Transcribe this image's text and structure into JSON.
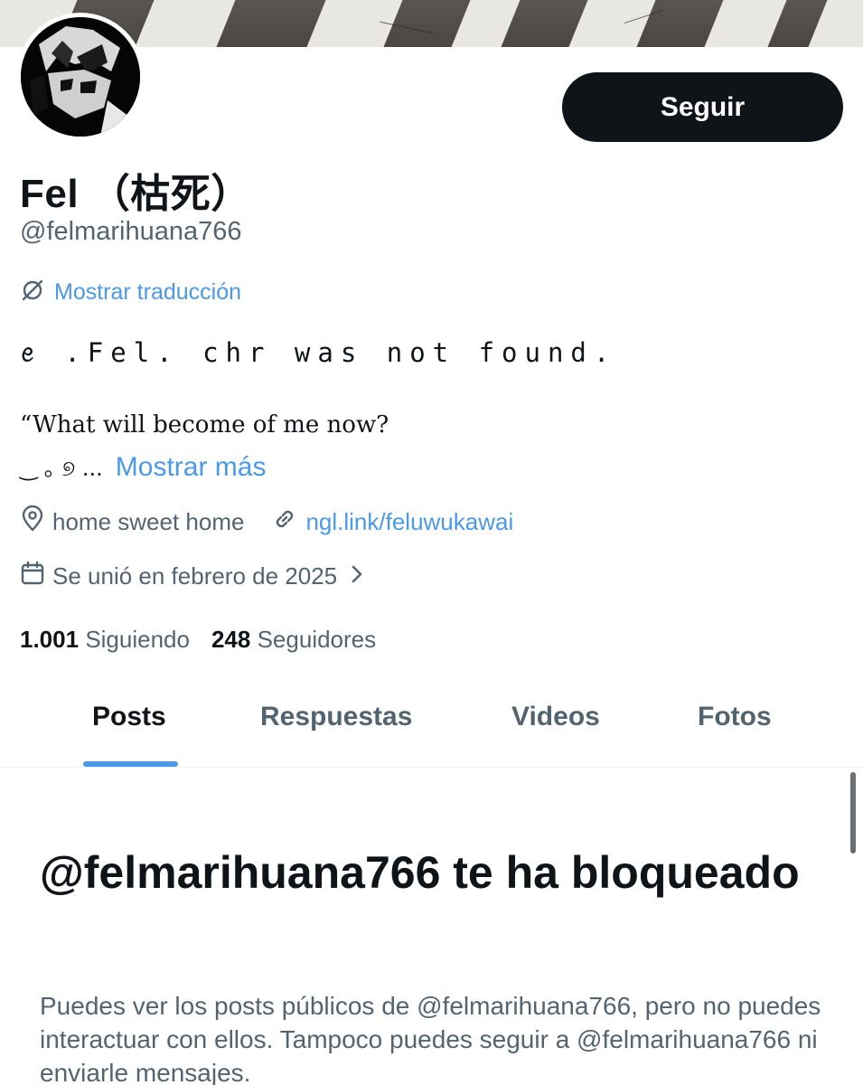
{
  "profile": {
    "display_name": "Fel （枯死）",
    "handle": "@felmarihuana766",
    "follow_label": "Seguir",
    "translate_label": "Mostrar traducción",
    "bio_line1": "ꫀ .Fel. chr was not found.",
    "bio_line2": "“What will become of me now?",
    "bio_line3_glyphs": "‿ ｡ ୭ ...",
    "show_more_label": "Mostrar más",
    "location": "home sweet home",
    "website": "ngl.link/feluwukawai",
    "joined": "Se unió en febrero de 2025",
    "following_count": "1.001",
    "following_label": "Siguiendo",
    "followers_count": "248",
    "followers_label": "Seguidores"
  },
  "tabs": [
    {
      "label": "Posts",
      "active": true
    },
    {
      "label": "Respuestas",
      "active": false
    },
    {
      "label": "Videos",
      "active": false
    },
    {
      "label": "Fotos",
      "active": false
    }
  ],
  "blocked": {
    "title": "@felmarihuana766 te ha bloqueado",
    "description": "Puedes ver los posts públicos de @felmarihuana766, pero no puedes interactuar con ellos. Tampoco puedes seguir a @felmarihuana766 ni enviarle mensajes."
  },
  "icons": {
    "translate": "translate-icon",
    "location": "location-pin-icon",
    "link": "link-icon",
    "calendar": "calendar-icon",
    "chevron": "chevron-right-icon"
  },
  "colors": {
    "accent": "#4a99e9",
    "text_primary": "#0f1419",
    "text_secondary": "#536471",
    "button_bg": "#0f1419"
  }
}
